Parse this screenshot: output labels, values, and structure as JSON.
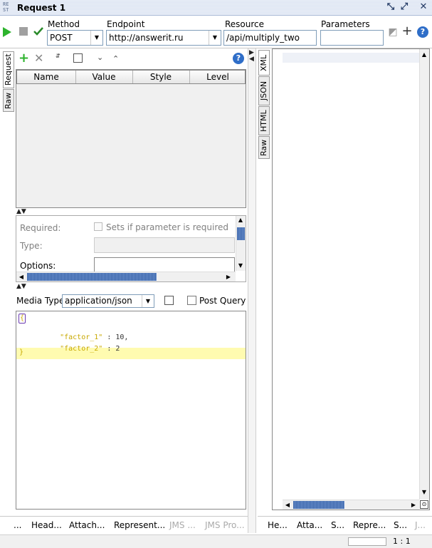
{
  "window": {
    "logo": [
      "RE",
      "ST"
    ],
    "title": "Request 1"
  },
  "toolbar": {
    "method_label": "Method",
    "method_value": "POST",
    "endpoint_label": "Endpoint",
    "endpoint_value": "http://answerit.ru",
    "resource_label": "Resource",
    "resource_value": "/api/multiply_two",
    "parameters_label": "Parameters",
    "parameters_value": "",
    "plus": "+",
    "help": "?"
  },
  "left_tabs": [
    "Request",
    "Raw"
  ],
  "params_table": {
    "columns": [
      "Name",
      "Value",
      "Style",
      "Level"
    ]
  },
  "param_details": {
    "required_label": "Required:",
    "required_checkbox_label": "Sets if parameter is required",
    "type_label": "Type:",
    "options_label": "Options:"
  },
  "media": {
    "label": "Media Type",
    "value": "application/json",
    "post_query_label": "Post QuerySt"
  },
  "body_code": {
    "open": "{",
    "line1_key": "\"factor_1\"",
    "line1_rest": " : 10,",
    "line2_key": "\"factor_2\"",
    "line2_rest": " : 2",
    "close": "}"
  },
  "response_tabs": [
    "XML",
    "JSON",
    "HTML",
    "Raw"
  ],
  "bottom_left_tabs": [
    "...",
    "Head...",
    "Attach...",
    "Represent...",
    "JMS ...",
    "JMS Pro..."
  ],
  "bottom_right_tabs": [
    "He...",
    "Atta...",
    "S...",
    "Repre...",
    "S...",
    "J..."
  ],
  "status": {
    "position": "1 : 1"
  },
  "colors": {
    "run_green": "#2db32d",
    "json_key": "#c8a800",
    "highlight_line": "#fffbb0",
    "cursor_purple": "#6a3ab0",
    "scroll_thumb": "#3a64a8"
  }
}
